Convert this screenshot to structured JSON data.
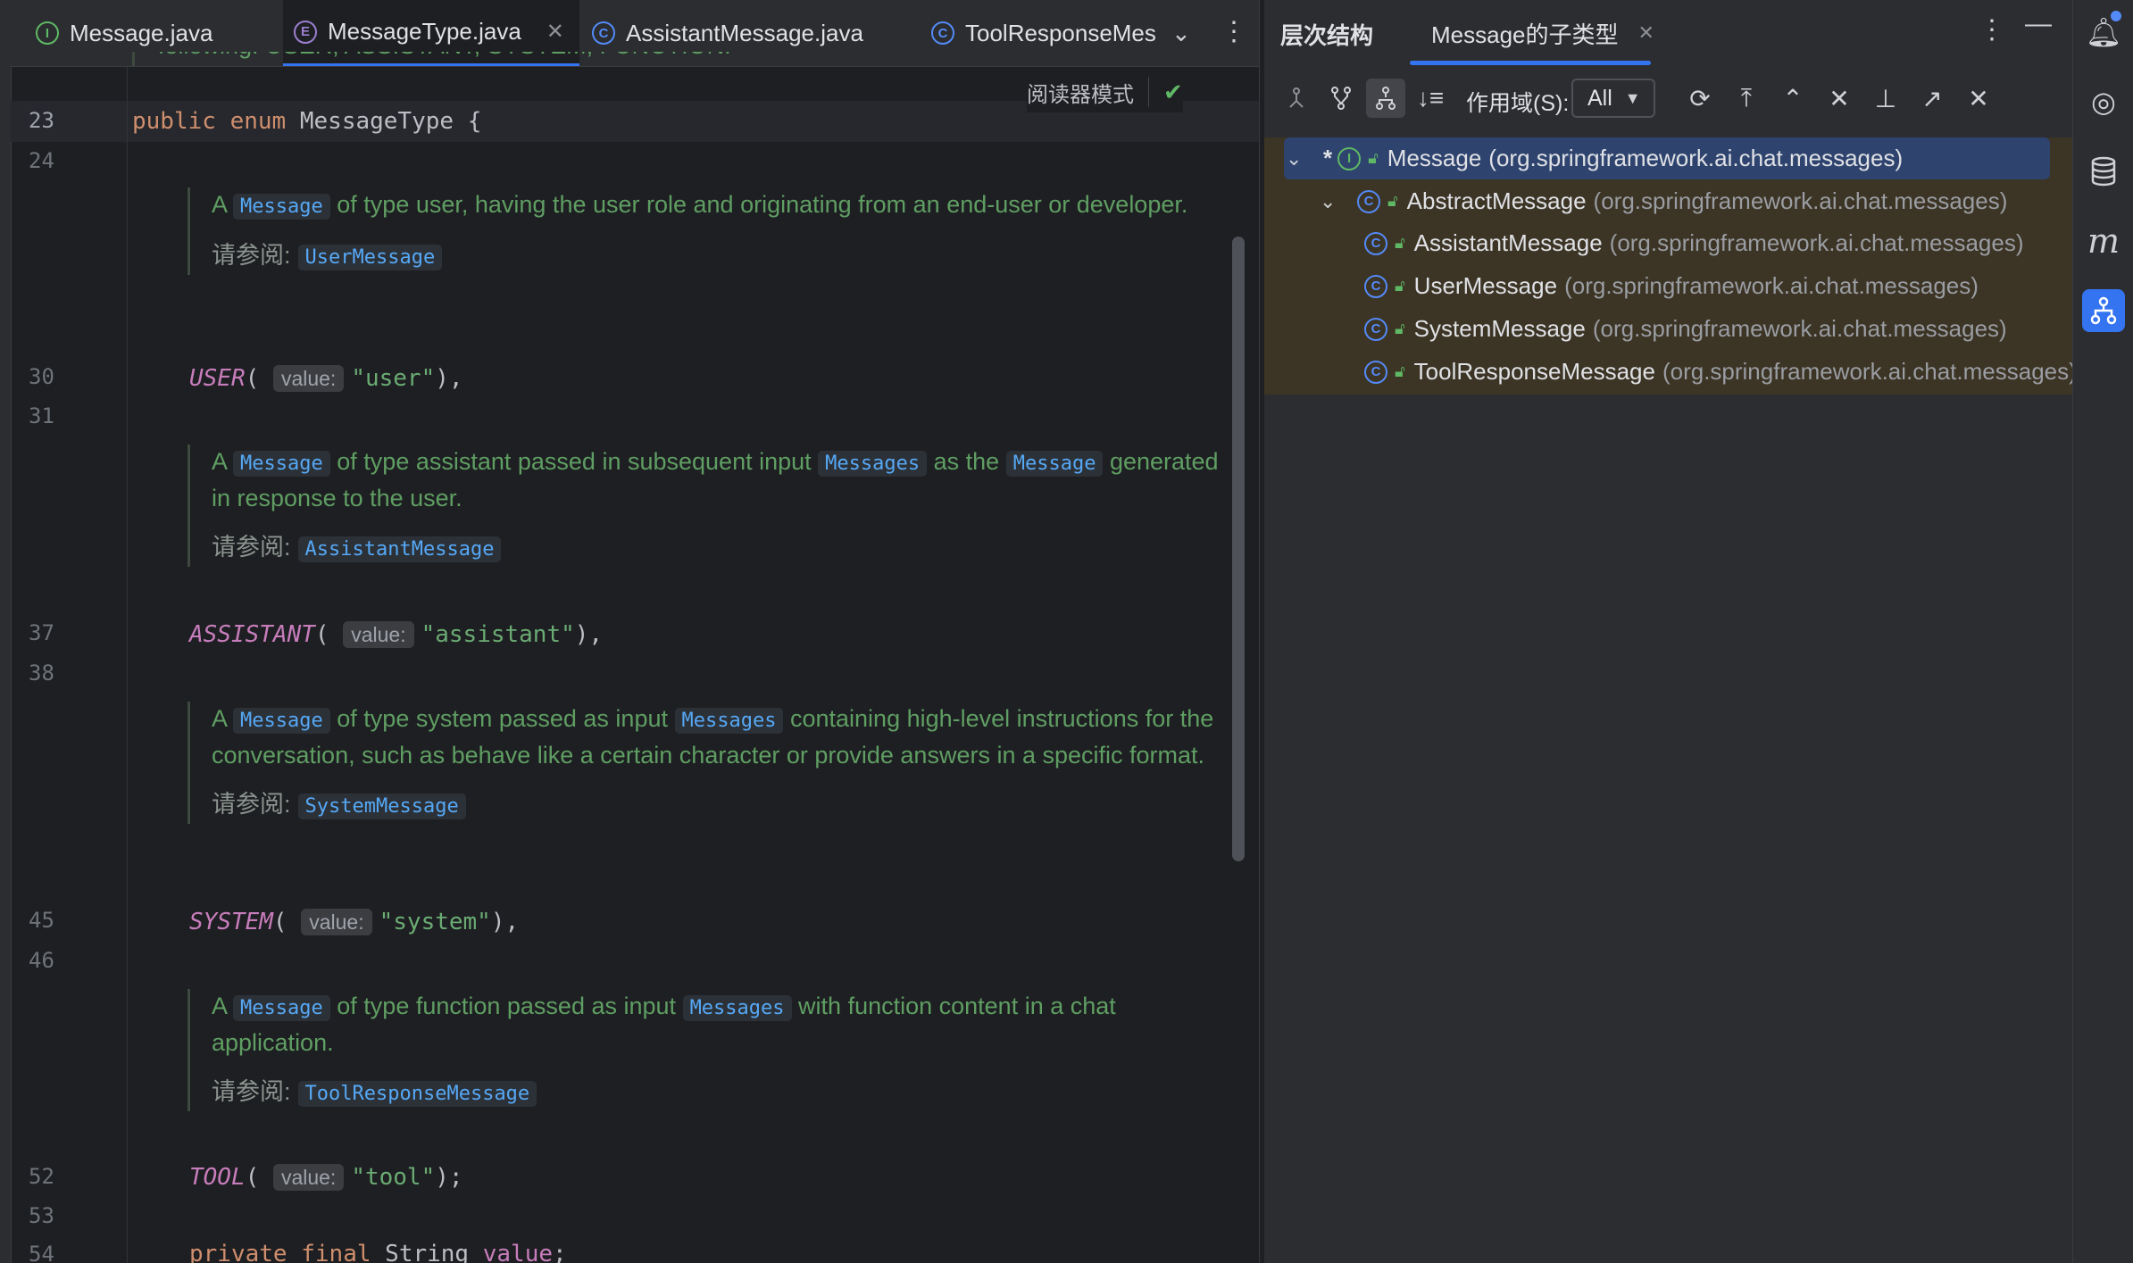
{
  "editor": {
    "tabs": [
      {
        "label": "Message.java",
        "icon": "I"
      },
      {
        "label": "MessageType.java",
        "icon": "E",
        "active": true
      },
      {
        "label": "AssistantMessage.java",
        "icon": "C"
      },
      {
        "label": "ToolResponseMes",
        "icon": "C"
      }
    ],
    "reader_mode": "阅读器模式",
    "top_partial_text": "following: USER, ASSISTANT, SYSTEM, FUNCTION.",
    "line_numbers": {
      "l23": "23",
      "l24": "24",
      "l30": "30",
      "l31": "31",
      "l37": "37",
      "l38": "38",
      "l45": "45",
      "l46": "46",
      "l52": "52",
      "l53": "53",
      "l54": "54"
    },
    "code": {
      "enum_decl": {
        "kw1": "public",
        "kw2": "enum",
        "name": " MessageType {"
      },
      "user": {
        "name": "USER",
        "hint": "value:",
        "value": "\"user\"",
        "tail": "),"
      },
      "assistant": {
        "name": "ASSISTANT",
        "hint": "value:",
        "value": "\"assistant\"",
        "tail": "),"
      },
      "system": {
        "name": "SYSTEM",
        "hint": "value:",
        "value": "\"system\"",
        "tail": "),"
      },
      "tool": {
        "name": "TOOL",
        "hint": "value:",
        "value": "\"tool\"",
        "tail": ");"
      },
      "field": {
        "kw1": "private",
        "kw2": "final",
        "type": " String ",
        "name": "value",
        "tail": ";"
      }
    },
    "docs": {
      "user": {
        "a": "A",
        "ref1": "Message",
        "t1": "of type user, having the user role and originating from an end-user or developer.",
        "see_label": "请参阅:",
        "see_ref": "UserMessage"
      },
      "assistant": {
        "a": "A",
        "ref1": "Message",
        "t1": "of type assistant passed in subsequent input",
        "ref2": "Messages",
        "t2": "as the",
        "ref3": "Message",
        "t3": "generated in response to the user.",
        "see_label": "请参阅:",
        "see_ref": "AssistantMessage"
      },
      "system": {
        "a": "A",
        "ref1": "Message",
        "t1": "of type system passed as input",
        "ref2": "Messages",
        "t2": "containing high-level instructions for the conversation, such as behave like a certain character or provide answers in a specific format.",
        "see_label": "请参阅:",
        "see_ref": "SystemMessage"
      },
      "tool": {
        "a": "A",
        "ref1": "Message",
        "t1": "of type function passed as input",
        "ref2": "Messages",
        "t2": "with function content in a chat application.",
        "see_label": "请参阅:",
        "see_ref": "ToolResponseMessage"
      }
    }
  },
  "hierarchy": {
    "title": "层次结构",
    "tab_label": "Message的子类型",
    "scope_label": "作用域(S):",
    "scope_value": "All",
    "tree": [
      {
        "name": "Message",
        "pkg": "(org.springframework.ai.chat.messages)",
        "kind": "I"
      },
      {
        "name": "AbstractMessage",
        "pkg": "(org.springframework.ai.chat.messages)",
        "kind": "C"
      },
      {
        "name": "AssistantMessage",
        "pkg": "(org.springframework.ai.chat.messages)",
        "kind": "C"
      },
      {
        "name": "UserMessage",
        "pkg": "(org.springframework.ai.chat.messages)",
        "kind": "C"
      },
      {
        "name": "SystemMessage",
        "pkg": "(org.springframework.ai.chat.messages)",
        "kind": "C"
      },
      {
        "name": "ToolResponseMessage",
        "pkg": "(org.springframework.ai.chat.messages)",
        "kind": "C"
      }
    ],
    "star": "*"
  },
  "colors": {
    "accent": "#3574f0",
    "selection": "#2e436e",
    "tree_highlight": "#3c3424",
    "doc_text": "#5f9e63",
    "keyword": "#cf8e6d",
    "enum_const": "#c77dbb",
    "string": "#6aab73"
  }
}
